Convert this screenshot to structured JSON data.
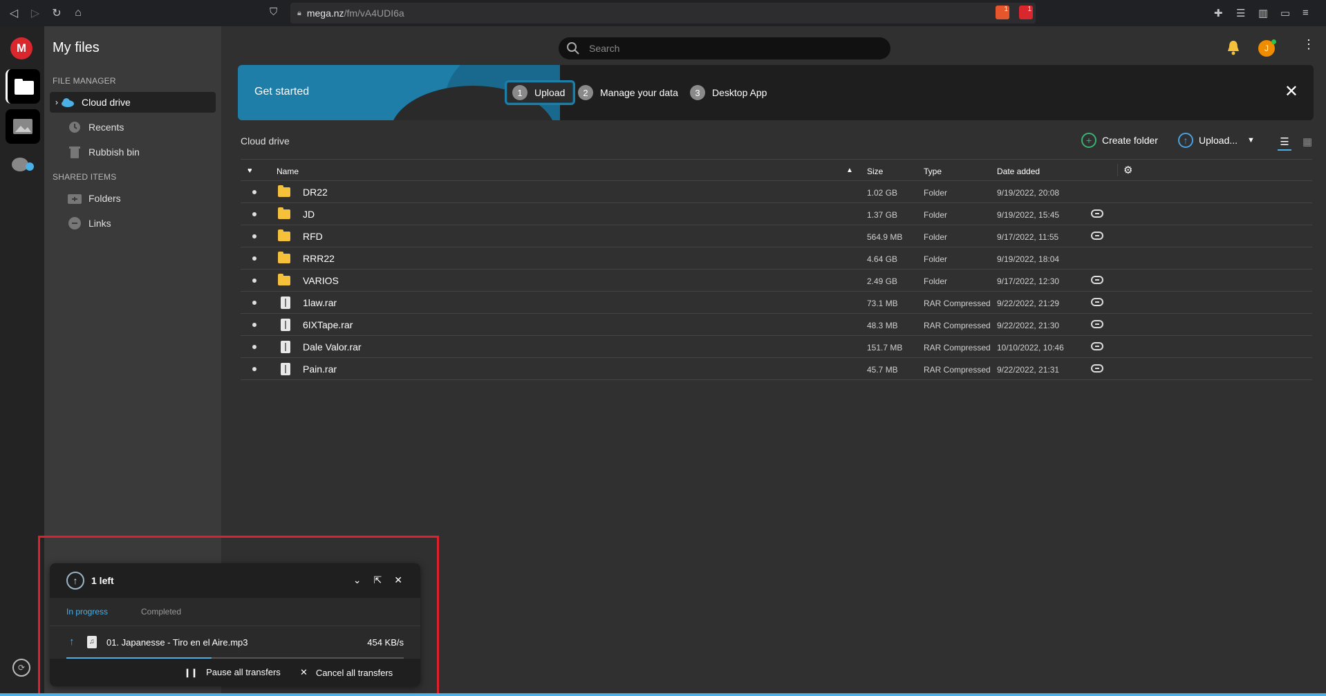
{
  "browser": {
    "url_host": "mega.nz",
    "url_path": "/fm/vA4UDI6a",
    "brave_badge": "1",
    "alert_badge": "1"
  },
  "sidebar": {
    "title": "My files",
    "file_manager_heading": "FILE MANAGER",
    "items": [
      {
        "label": "Cloud drive"
      },
      {
        "label": "Recents"
      },
      {
        "label": "Rubbish bin"
      }
    ],
    "shared_heading": "SHARED ITEMS",
    "shared_items": [
      {
        "label": "Folders"
      },
      {
        "label": "Links"
      }
    ]
  },
  "header": {
    "search_placeholder": "Search",
    "avatar_initial": "J"
  },
  "banner": {
    "title": "Get started",
    "steps": [
      {
        "num": "1",
        "label": "Upload"
      },
      {
        "num": "2",
        "label": "Manage your data"
      },
      {
        "num": "3",
        "label": "Desktop App"
      }
    ]
  },
  "toolbar": {
    "breadcrumb": "Cloud drive",
    "create_folder": "Create folder",
    "upload": "Upload..."
  },
  "table": {
    "headers": {
      "name": "Name",
      "size": "Size",
      "type": "Type",
      "date": "Date added"
    },
    "rows": [
      {
        "name": "DR22",
        "size": "1.02 GB",
        "type": "Folder",
        "date": "9/19/2022, 20:08",
        "kind": "folder",
        "link": false
      },
      {
        "name": "JD",
        "size": "1.37 GB",
        "type": "Folder",
        "date": "9/19/2022, 15:45",
        "kind": "folder",
        "link": true
      },
      {
        "name": "RFD",
        "size": "564.9 MB",
        "type": "Folder",
        "date": "9/17/2022, 11:55",
        "kind": "folder",
        "link": true
      },
      {
        "name": "RRR22",
        "size": "4.64 GB",
        "type": "Folder",
        "date": "9/19/2022, 18:04",
        "kind": "folder",
        "link": false
      },
      {
        "name": "VARIOS",
        "size": "2.49 GB",
        "type": "Folder",
        "date": "9/17/2022, 12:30",
        "kind": "folder",
        "link": true
      },
      {
        "name": "1law.rar",
        "size": "73.1 MB",
        "type": "RAR Compressed",
        "date": "9/22/2022, 21:29",
        "kind": "file",
        "link": true
      },
      {
        "name": "6IXTape.rar",
        "size": "48.3 MB",
        "type": "RAR Compressed",
        "date": "9/22/2022, 21:30",
        "kind": "file",
        "link": true
      },
      {
        "name": "Dale Valor.rar",
        "size": "151.7 MB",
        "type": "RAR Compressed",
        "date": "10/10/2022, 10:46",
        "kind": "file",
        "link": true
      },
      {
        "name": "Pain.rar",
        "size": "45.7 MB",
        "type": "RAR Compressed",
        "date": "9/22/2022, 21:31",
        "kind": "file",
        "link": true
      }
    ]
  },
  "transfers": {
    "title": "1 left",
    "tab_in_progress": "In progress",
    "tab_completed": "Completed",
    "item_name": "01. Japanesse - Tiro en el Aire.mp3",
    "item_speed": "454 KB/s",
    "progress": 0.43,
    "pause_all": "Pause all transfers",
    "cancel_all": "Cancel all transfers"
  },
  "colors": {
    "accent": "#4ab0e6",
    "brand": "#d9272e",
    "folder": "#f6c13a",
    "highlight_frame": "#e0202a"
  }
}
